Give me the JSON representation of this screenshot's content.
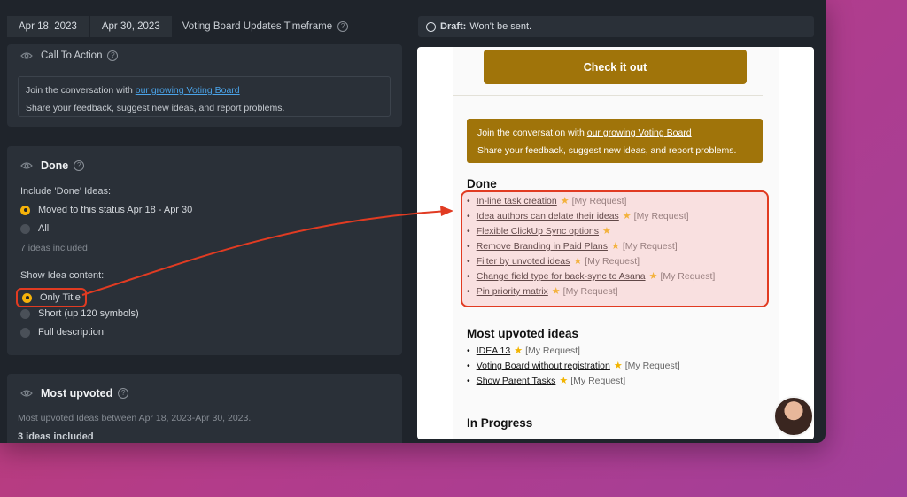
{
  "header": {
    "date_from": "Apr 18, 2023",
    "date_to": "Apr 30, 2023",
    "timeframe_label": "Voting Board Updates Timeframe"
  },
  "cta_panel": {
    "title": "Call To Action",
    "line1_prefix": "Join the conversation with ",
    "line1_link": "our growing Voting Board",
    "line2": "Share your feedback, suggest new ideas, and report problems."
  },
  "done_panel": {
    "title": "Done",
    "include_label": "Include 'Done' Ideas:",
    "include_options": [
      "Moved to this status Apr 18 - Apr 30",
      "All"
    ],
    "include_selected": 0,
    "ideas_count": "7 ideas included",
    "content_label": "Show Idea content:",
    "content_options": [
      "Only Title",
      "Short (up 120 symbols)",
      "Full description"
    ],
    "content_selected": 0
  },
  "upvoted_panel": {
    "title": "Most upvoted",
    "description": "Most upvoted Ideas between Apr 18, 2023-Apr 30, 2023.",
    "count": "3 ideas included"
  },
  "preview": {
    "draft_label": "Draft:",
    "draft_text": "Won't be sent.",
    "button_label": "Check it out",
    "join_prefix": "Join the conversation with ",
    "join_link": "our growing Voting Board",
    "join_line2": "Share your feedback, suggest new ideas, and report problems.",
    "done_heading": "Done",
    "done_items": [
      {
        "title": "In-line task creation",
        "tag": "[My Request]"
      },
      {
        "title": "Idea authors can delate their ideas",
        "tag": "[My Request]"
      },
      {
        "title": "Flexible ClickUp Sync options",
        "tag": ""
      },
      {
        "title": "Remove Branding in Paid Plans",
        "tag": "[My Request]"
      },
      {
        "title": "Filter by unvoted ideas",
        "tag": "[My Request]"
      },
      {
        "title": "Change field type for back-sync to Asana",
        "tag": "[My Request]"
      },
      {
        "title": "Pin priority matrix",
        "tag": "[My Request]"
      }
    ],
    "upvoted_heading": "Most upvoted ideas",
    "upvoted_items": [
      {
        "title": "IDEA 13",
        "tag": "[My Request]"
      },
      {
        "title": "Voting Board without registration",
        "tag": "[My Request]"
      },
      {
        "title": "Show Parent Tasks",
        "tag": "[My Request]"
      }
    ],
    "progress_heading": "In Progress"
  },
  "colors": {
    "accent": "#f5b20a",
    "button": "#a0740a",
    "annotation": "#e13b22",
    "panel": "#2a3038",
    "background": "#1f242b"
  }
}
